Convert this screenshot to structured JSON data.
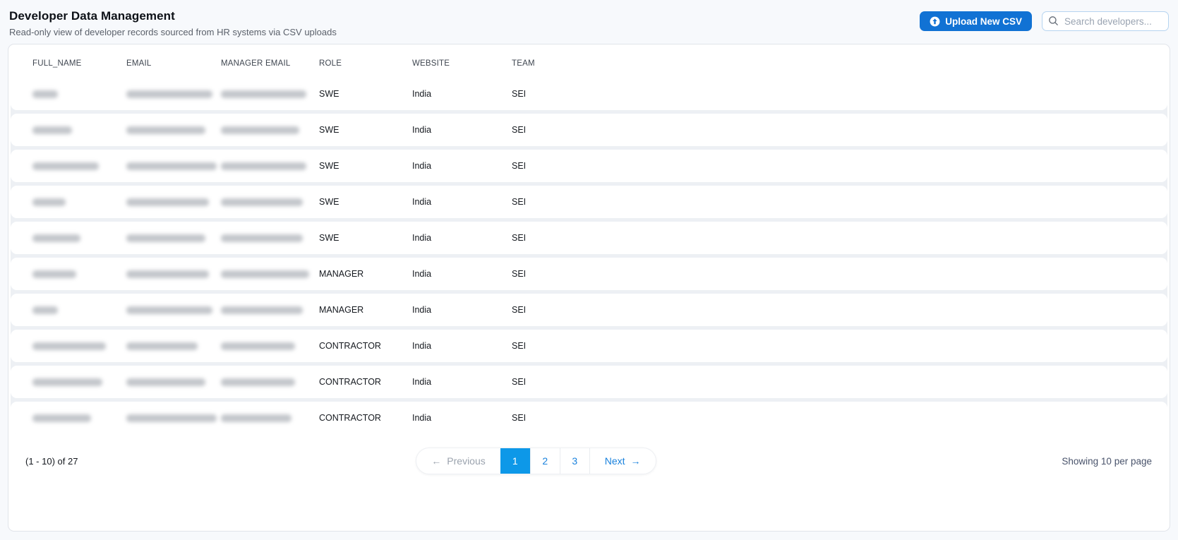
{
  "page": {
    "title": "Developer Data Management",
    "subtitle": "Read-only view of developer records sourced from HR systems via CSV uploads"
  },
  "toolbar": {
    "upload_button_label": "Upload New CSV",
    "upload_icon": "arrow-up-circle-icon",
    "search_placeholder": "Search developers...",
    "search_icon": "magnifier-icon"
  },
  "table": {
    "columns": [
      "FULL_NAME",
      "EMAIL",
      "MANAGER EMAIL",
      "ROLE",
      "WEBSITE",
      "TEAM"
    ],
    "redacted_columns": [
      "FULL_NAME",
      "EMAIL",
      "MANAGER EMAIL"
    ],
    "rows": [
      {
        "full_name_blur_width": 36,
        "email_blur_width": 122,
        "manager_email_blur_width": 121,
        "role": "SWE",
        "website": "India",
        "team": "SEI"
      },
      {
        "full_name_blur_width": 56,
        "email_blur_width": 112,
        "manager_email_blur_width": 111,
        "role": "SWE",
        "website": "India",
        "team": "SEI"
      },
      {
        "full_name_blur_width": 94,
        "email_blur_width": 128,
        "manager_email_blur_width": 121,
        "role": "SWE",
        "website": "India",
        "team": "SEI"
      },
      {
        "full_name_blur_width": 47,
        "email_blur_width": 117,
        "manager_email_blur_width": 116,
        "role": "SWE",
        "website": "India",
        "team": "SEI"
      },
      {
        "full_name_blur_width": 68,
        "email_blur_width": 112,
        "manager_email_blur_width": 116,
        "role": "SWE",
        "website": "India",
        "team": "SEI"
      },
      {
        "full_name_blur_width": 62,
        "email_blur_width": 117,
        "manager_email_blur_width": 125,
        "role": "MANAGER",
        "website": "India",
        "team": "SEI"
      },
      {
        "full_name_blur_width": 36,
        "email_blur_width": 122,
        "manager_email_blur_width": 116,
        "role": "MANAGER",
        "website": "India",
        "team": "SEI"
      },
      {
        "full_name_blur_width": 104,
        "email_blur_width": 101,
        "manager_email_blur_width": 105,
        "role": "CONTRACTOR",
        "website": "India",
        "team": "SEI"
      },
      {
        "full_name_blur_width": 99,
        "email_blur_width": 112,
        "manager_email_blur_width": 105,
        "role": "CONTRACTOR",
        "website": "India",
        "team": "SEI"
      },
      {
        "full_name_blur_width": 83,
        "email_blur_width": 128,
        "manager_email_blur_width": 100,
        "role": "CONTRACTOR",
        "website": "India",
        "team": "SEI"
      }
    ]
  },
  "pagination": {
    "range_label": "(1 - 10) of 27",
    "previous": {
      "arrow": "←",
      "label": "Previous",
      "disabled": true
    },
    "pages": [
      {
        "label": "1",
        "active": true
      },
      {
        "label": "2",
        "active": false
      },
      {
        "label": "3",
        "active": false
      }
    ],
    "next": {
      "label": "Next",
      "arrow": "→"
    },
    "per_page_label": "Showing 10 per page"
  },
  "colors": {
    "upload_button_blue": "#1172d4",
    "active_page_blue": "#0d98e8",
    "link_blue": "#1a82dd",
    "page_background": "#f7f9fc",
    "card_border": "#e1e4ea"
  }
}
